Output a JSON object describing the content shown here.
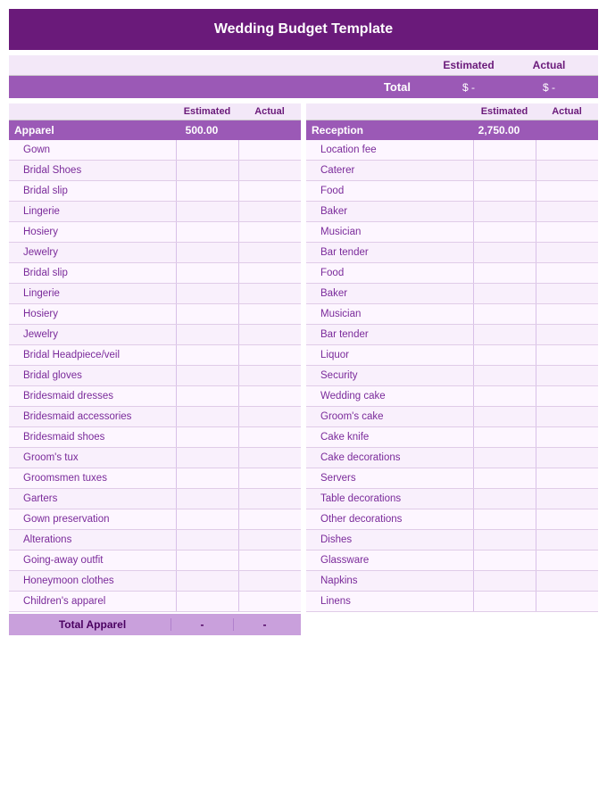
{
  "title": "Wedding Budget Template",
  "summary": {
    "estimated_label": "Estimated",
    "actual_label": "Actual",
    "total_label": "Total",
    "estimated_value": "$ -",
    "actual_value": "$ -"
  },
  "left": {
    "section_label": "Apparel",
    "section_estimated": "500.00",
    "col_headers": [
      "Estimated",
      "Actual"
    ],
    "items": [
      "Gown",
      "Bridal Shoes",
      "Bridal slip",
      "Lingerie",
      "Hosiery",
      "Jewelry",
      "Bridal slip",
      "Lingerie",
      "Hosiery",
      "Jewelry",
      "Bridal Headpiece/veil",
      "Bridal gloves",
      "Bridesmaid dresses",
      "Bridesmaid accessories",
      "Bridesmaid shoes",
      "Groom's tux",
      "Groomsmen tuxes",
      "Garters",
      "Gown preservation",
      "Alterations",
      "Going-away outfit",
      "Honeymoon clothes",
      "Children's apparel"
    ],
    "total_label": "Total Apparel",
    "total_estimated": "-",
    "total_actual": "-"
  },
  "right": {
    "section_label": "Reception",
    "section_estimated": "2,750.00",
    "col_headers": [
      "Estimated",
      "Actual"
    ],
    "items": [
      "Location fee",
      "Caterer",
      "Food",
      "Baker",
      "Musician",
      "Bar tender",
      "Food",
      "Baker",
      "Musician",
      "Bar tender",
      "Liquor",
      "Security",
      "Wedding cake",
      "Groom's cake",
      "Cake knife",
      "Cake decorations",
      "Servers",
      "Table decorations",
      "Other decorations",
      "Dishes",
      "Glassware",
      "Napkins",
      "Linens"
    ]
  }
}
